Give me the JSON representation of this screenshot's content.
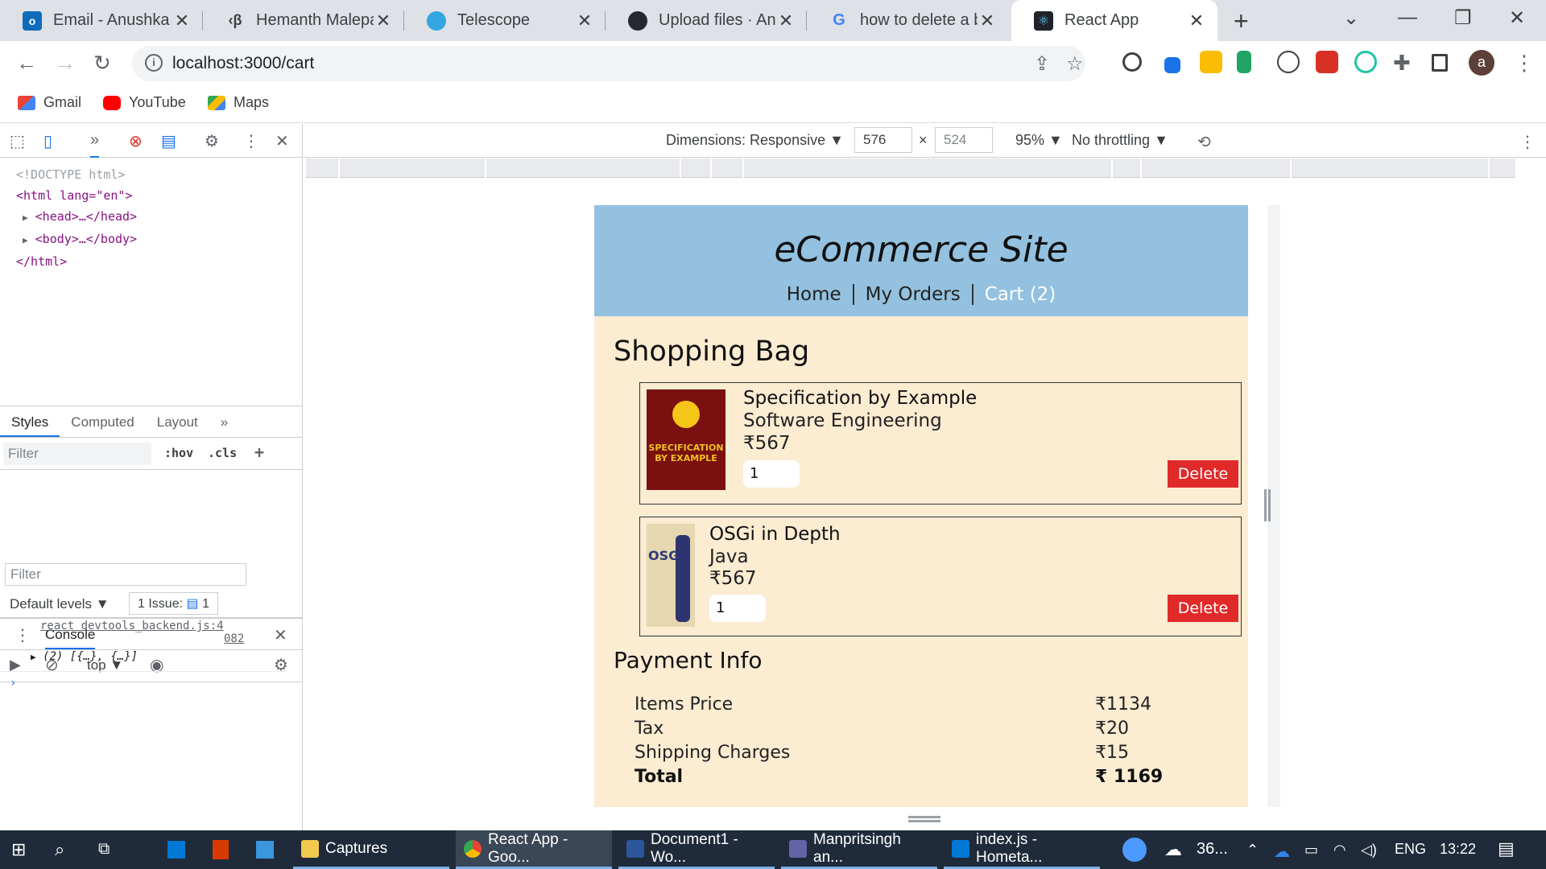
{
  "browser": {
    "tabs": [
      {
        "title": "Email - Anushka Ag",
        "favicon": "outlook-icon",
        "color": "#0f6cbd"
      },
      {
        "title": "Hemanth Malepati",
        "favicon": "code-icon",
        "color": "#3c4043"
      },
      {
        "title": "Telescope",
        "favicon": "telescope-icon",
        "color": "#33a6e0"
      },
      {
        "title": "Upload files · Anush",
        "favicon": "github-icon",
        "color": "#24292f"
      },
      {
        "title": "how to delete a bra",
        "favicon": "google-icon",
        "color": "#4285f4"
      },
      {
        "title": "React App",
        "favicon": "react-icon",
        "color": "#61dafb"
      }
    ],
    "url": "localhost:3000/cart",
    "bookmarks": [
      {
        "label": "Gmail",
        "icon": "gmail-icon"
      },
      {
        "label": "YouTube",
        "icon": "youtube-icon"
      },
      {
        "label": "Maps",
        "icon": "maps-icon"
      }
    ],
    "profile_initial": "a"
  },
  "devtools": {
    "dom": {
      "doctype": "<!DOCTYPE html>",
      "html_open": "<html lang=\"en\">",
      "head": "<head>…</head>",
      "body": "<body>…</body>",
      "html_close": "</html>"
    },
    "styles_tabs": [
      "Styles",
      "Computed",
      "Layout"
    ],
    "filter_placeholder": "Filter",
    "hov": ":hov",
    "cls": ".cls",
    "console_label": "Console",
    "context": "top",
    "console_filter": "Filter",
    "levels": "Default levels",
    "issues": "1 Issue:",
    "issues_count": "1",
    "log_source": "react_devtools_backend.js:4",
    "log_source_line": "082",
    "log_value": "(2) [{…}, {…}]"
  },
  "device_toolbar": {
    "dimensions": "Dimensions: Responsive",
    "width": "576",
    "height": "524",
    "zoom": "95%",
    "throttling": "No throttling"
  },
  "app": {
    "title": "eCommerce Site",
    "nav": [
      "Home",
      "My Orders",
      "Cart (2)"
    ],
    "bag_title": "Shopping Bag",
    "items": [
      {
        "name": "Specification by Example",
        "category": "Software Engineering",
        "price": "₹567",
        "qty": "1",
        "delete": "Delete",
        "cover_title": "SPECIFICATION BY EXAMPLE"
      },
      {
        "name": "OSGi in Depth",
        "category": "Java",
        "price": "₹567",
        "qty": "1",
        "delete": "Delete",
        "cover_title": "OSGi"
      }
    ],
    "payment_title": "Payment Info",
    "payment": [
      {
        "label": "Items Price",
        "value": "₹1134"
      },
      {
        "label": "Tax",
        "value": "₹20"
      },
      {
        "label": "Shipping Charges",
        "value": "₹15"
      },
      {
        "label": "Total",
        "value": "₹ 1169"
      }
    ]
  },
  "taskbar": {
    "apps": [
      {
        "label": "Captures",
        "color": "#f2c94c"
      },
      {
        "label": "React App - Goo...",
        "color": "#4285f4"
      },
      {
        "label": "Document1 - Wo...",
        "color": "#2b579a"
      },
      {
        "label": "Manpritsingh an...",
        "color": "#6264a7"
      },
      {
        "label": "index.js - Hometa...",
        "color": "#0078d4"
      }
    ],
    "weather": "36...",
    "language": "ENG",
    "time": "13:22"
  }
}
